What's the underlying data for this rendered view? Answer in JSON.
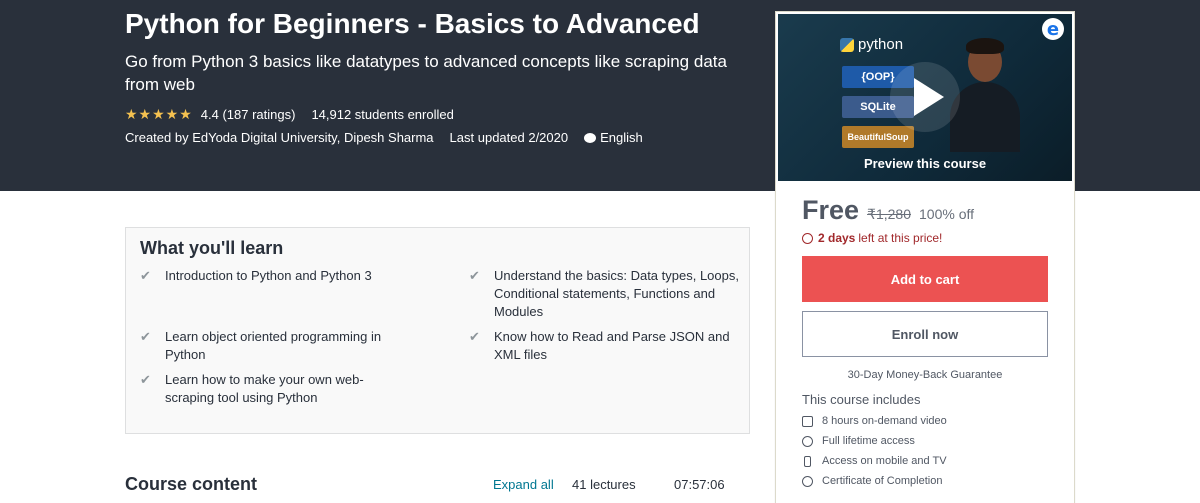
{
  "hero": {
    "title": "Python for Beginners - Basics to Advanced",
    "subtitle": "Go from Python 3 basics like datatypes to advanced concepts like scraping data from web",
    "stars": "★★★★★",
    "rating": "4.4 (187 ratings)",
    "students": "14,912 students enrolled",
    "created_by": "Created by EdYoda Digital University, Dipesh Sharma",
    "last_updated": "Last updated 2/2020",
    "language": "English"
  },
  "preview": {
    "label": "Preview this course",
    "thumb_python": "python",
    "thumb_oop": "{OOP}",
    "thumb_sqlite": "SQLite",
    "thumb_bs": "BeautifulSoup",
    "brand_letter": "e"
  },
  "pricing": {
    "price": "Free",
    "old_price": "₹1,280",
    "discount": "100% off",
    "timer_bold": "2 days",
    "timer_text": "left at this price!",
    "add_to_cart": "Add to cart",
    "enroll_now": "Enroll now",
    "guarantee": "30-Day Money-Back Guarantee"
  },
  "includes": {
    "title": "This course includes",
    "items": [
      "8 hours on-demand video",
      "Full lifetime access",
      "Access on mobile and TV",
      "Certificate of Completion"
    ]
  },
  "learn": {
    "title": "What you'll learn",
    "items": [
      "Introduction to Python and Python 3",
      "Understand the basics: Data types, Loops, Conditional statements, Functions and Modules",
      "Learn object oriented programming in Python",
      "Know how to Read and Parse JSON and XML files",
      "Learn how to make your own web-scraping tool using Python"
    ]
  },
  "course_content": {
    "title": "Course content",
    "expand_all": "Expand all",
    "lectures": "41 lectures",
    "duration": "07:57:06"
  },
  "colors": {
    "hero_bg": "#29303b",
    "star": "#f4c150",
    "cart_button": "#ec5252",
    "timer": "#a1282b",
    "link": "#007791"
  }
}
